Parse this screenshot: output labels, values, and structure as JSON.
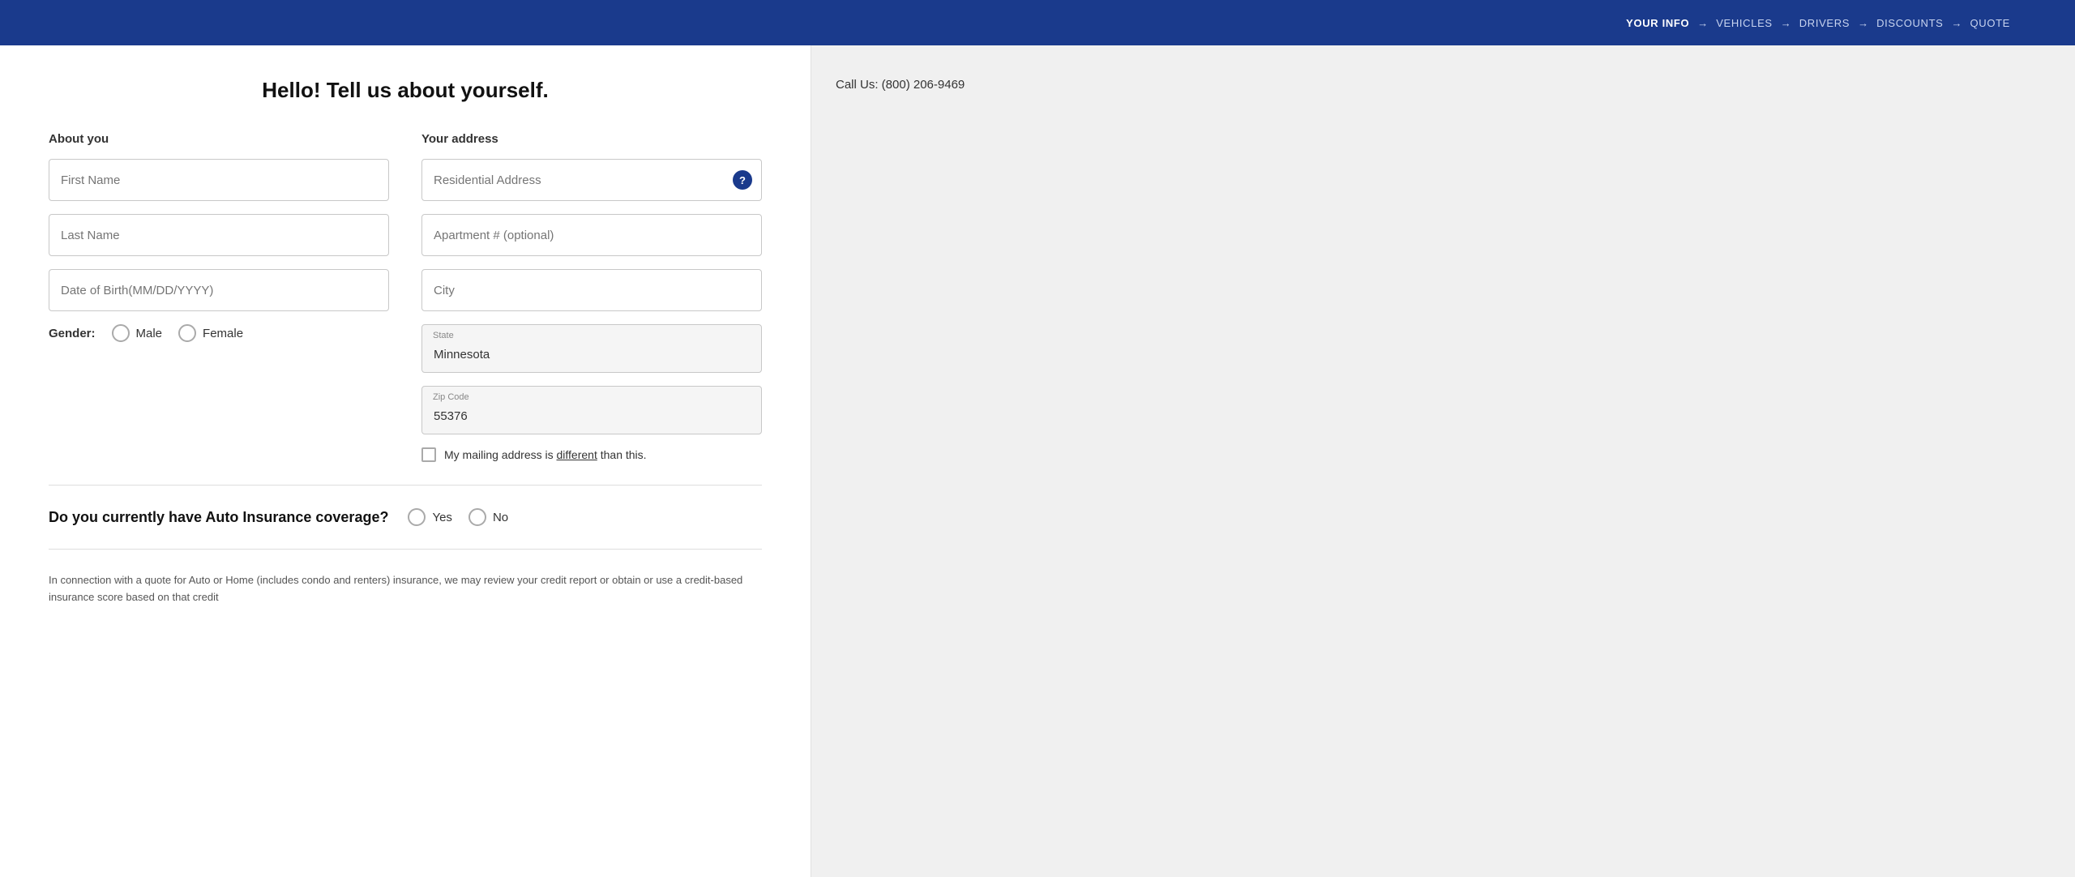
{
  "nav": {
    "steps": [
      {
        "key": "your-info",
        "label": "YOUR INFO",
        "active": true
      },
      {
        "key": "vehicles",
        "label": "VEHICLES",
        "active": false
      },
      {
        "key": "drivers",
        "label": "DRIVERS",
        "active": false
      },
      {
        "key": "discounts",
        "label": "DISCOUNTS",
        "active": false
      },
      {
        "key": "quote",
        "label": "QUOTE",
        "active": false
      }
    ],
    "arrow": "→"
  },
  "page": {
    "title": "Hello! Tell us about yourself."
  },
  "about_you": {
    "section_label": "About you",
    "first_name_placeholder": "First Name",
    "last_name_placeholder": "Last Name",
    "dob_placeholder": "Date of Birth(MM/DD/YYYY)",
    "gender_label": "Gender:",
    "gender_options": [
      {
        "value": "male",
        "label": "Male"
      },
      {
        "value": "female",
        "label": "Female"
      }
    ]
  },
  "your_address": {
    "section_label": "Your address",
    "residential_address_placeholder": "Residential Address",
    "apartment_placeholder": "Apartment # (optional)",
    "city_placeholder": "City",
    "state_inner_label": "State",
    "state_value": "Minnesota",
    "zip_inner_label": "Zip Code",
    "zip_value": "55376",
    "mailing_checkbox_text": "My mailing address is ",
    "mailing_checkbox_different": "different",
    "mailing_checkbox_suffix": " than this."
  },
  "insurance_question": {
    "text": "Do you currently have Auto Insurance coverage?",
    "yes_label": "Yes",
    "no_label": "No"
  },
  "disclaimer": {
    "text": "In connection with a quote for Auto or Home (includes condo and renters) insurance, we may review your credit report or obtain or use a credit-based insurance score based on that credit"
  },
  "sidebar": {
    "call_us": "Call Us: (800) 206-9469"
  }
}
